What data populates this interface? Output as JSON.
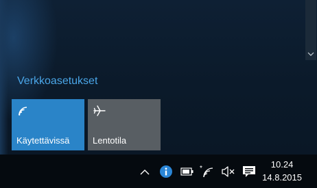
{
  "flyout": {
    "network_settings_label": "Verkkoasetukset",
    "tiles": [
      {
        "label": "Käytettävissä",
        "icon": "wifi-icon",
        "state": "active",
        "color": "#2a84c8"
      },
      {
        "label": "Lentotila",
        "icon": "airplane-icon",
        "state": "inactive",
        "color": "#585e63"
      }
    ]
  },
  "taskbar": {
    "tray_icons": [
      "chevron-up-icon",
      "info-icon",
      "battery-icon",
      "wifi-icon",
      "mute-icon",
      "action-center-icon"
    ],
    "clock": {
      "time": "10.24",
      "date": "14.8.2015"
    }
  },
  "colors": {
    "accent": "#2a84c8",
    "link": "#4aa6e8",
    "taskbar": "#050a0f"
  }
}
